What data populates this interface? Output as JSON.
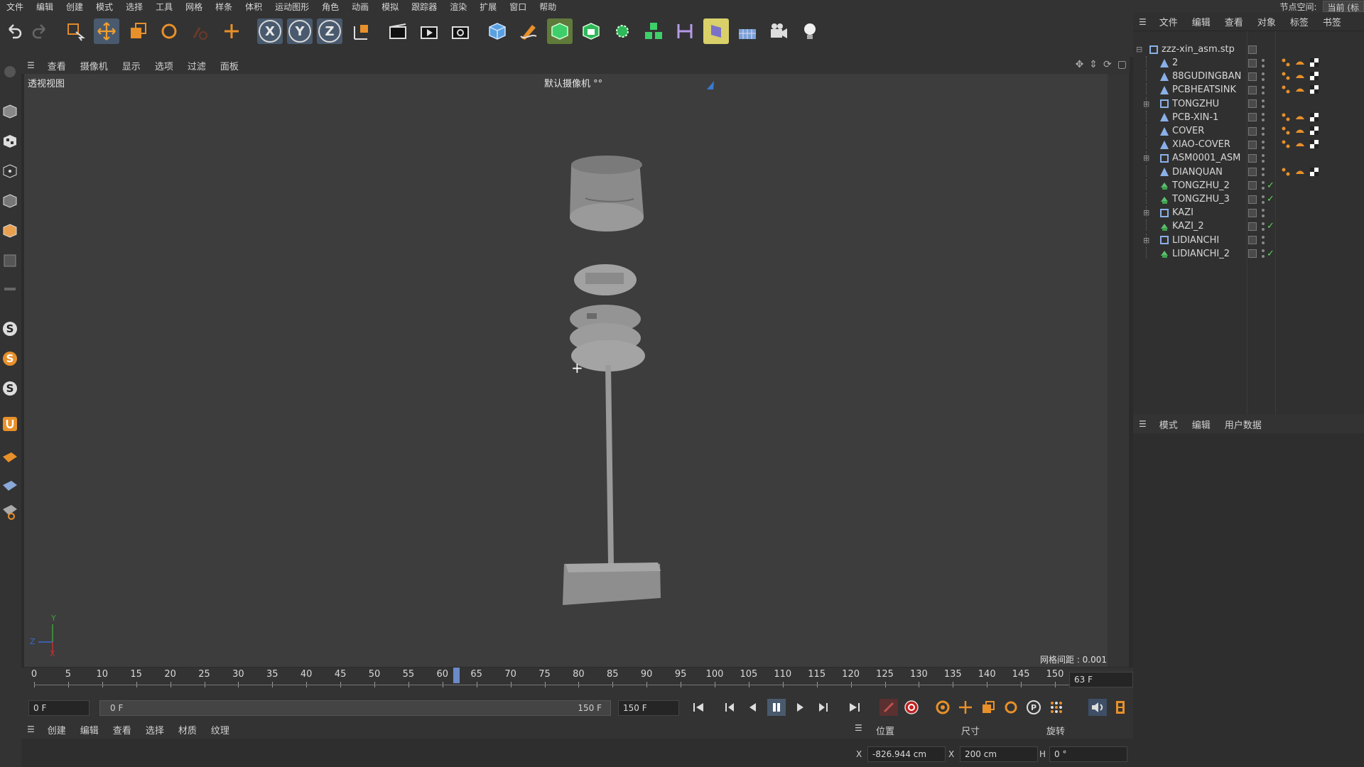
{
  "menubar": {
    "items": [
      "文件",
      "编辑",
      "创建",
      "模式",
      "选择",
      "工具",
      "网格",
      "样条",
      "体积",
      "运动图形",
      "角色",
      "动画",
      "模拟",
      "跟踪器",
      "渲染",
      "扩展",
      "窗口",
      "帮助"
    ],
    "node_space_label": "节点空间:",
    "node_space_value": "当前 (标"
  },
  "viewport": {
    "menu": [
      "查看",
      "摄像机",
      "显示",
      "选项",
      "过滤",
      "面板"
    ],
    "view_name": "透视视图",
    "camera_label": "默认摄像机",
    "grid_spacing": "网格间距 : 0.001 cm",
    "axis_y": "Y",
    "axis_z": "Z",
    "axis_x": "X"
  },
  "object_manager": {
    "menu": [
      "文件",
      "编辑",
      "查看",
      "对象",
      "标签",
      "书签"
    ],
    "root": "zzz-xin_asm.stp",
    "objects": [
      {
        "name": "2",
        "type": "mesh",
        "tags": true
      },
      {
        "name": "88GUDINGBAN",
        "type": "mesh",
        "tags": true
      },
      {
        "name": "PCBHEATSINK",
        "type": "mesh",
        "tags": true
      },
      {
        "name": "TONGZHU",
        "type": "null",
        "tags": false
      },
      {
        "name": "PCB-XIN-1",
        "type": "mesh",
        "tags": true
      },
      {
        "name": "COVER",
        "type": "mesh",
        "tags": true
      },
      {
        "name": "XIAO-COVER",
        "type": "mesh",
        "tags": true
      },
      {
        "name": "ASM0001_ASM",
        "type": "null",
        "tags": false
      },
      {
        "name": "DIANQUAN",
        "type": "mesh",
        "tags": true
      },
      {
        "name": "TONGZHU_2",
        "type": "instance",
        "tags": false
      },
      {
        "name": "TONGZHU_3",
        "type": "instance",
        "tags": false
      },
      {
        "name": "KAZI",
        "type": "null",
        "tags": false
      },
      {
        "name": "KAZI_2",
        "type": "instance",
        "tags": false
      },
      {
        "name": "LIDIANCHI",
        "type": "null",
        "tags": false
      },
      {
        "name": "LIDIANCHI_2",
        "type": "instance",
        "tags": false
      }
    ]
  },
  "attributes": {
    "menu": [
      "模式",
      "编辑",
      "用户数据"
    ]
  },
  "timeline": {
    "ticks": [
      0,
      5,
      10,
      15,
      20,
      25,
      30,
      35,
      40,
      45,
      50,
      55,
      60,
      65,
      70,
      75,
      80,
      85,
      90,
      95,
      100,
      105,
      110,
      115,
      120,
      125,
      130,
      135,
      140,
      145,
      150
    ],
    "current_frame": "63 F",
    "playhead": 62
  },
  "transport": {
    "start": "0 F",
    "range_start": "0 F",
    "range_end": "150 F",
    "end": "150 F"
  },
  "material": {
    "menu": [
      "创建",
      "编辑",
      "查看",
      "选择",
      "材质",
      "纹理"
    ]
  },
  "coords": {
    "position_label": "位置",
    "size_label": "尺寸",
    "rotation_label": "旋转",
    "x_label": "X",
    "x_value": "-826.944 cm",
    "sx_label": "X",
    "sx_value": "200 cm",
    "h_label": "H",
    "h_value": "0 °"
  },
  "colors": {
    "accent_blue": "#4a5a6e",
    "highlight_yellow": "#d9d06a",
    "check_green": "#5fd35f"
  }
}
